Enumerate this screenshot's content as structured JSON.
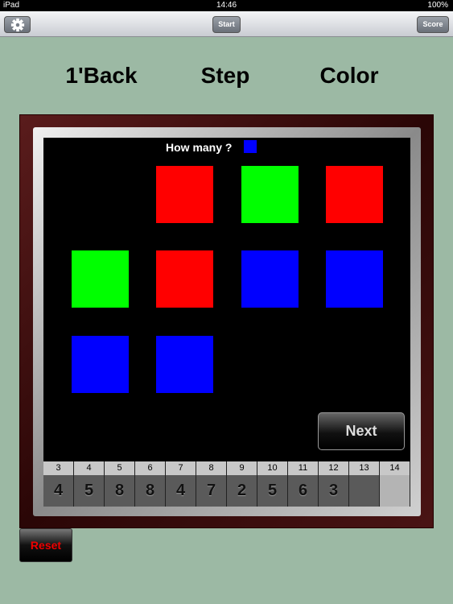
{
  "status": {
    "device": "iPad",
    "time": "14:46",
    "battery": "100%"
  },
  "toolbar": {
    "settings_icon": "gear-icon",
    "start": "Start",
    "score": "Score"
  },
  "titles": [
    "1'Back",
    "Step",
    "Color"
  ],
  "question": {
    "label": "How many ?",
    "color": "#0000ff"
  },
  "grid": [
    [
      null,
      "#ff0000",
      "#00ff00",
      "#ff0000"
    ],
    [
      "#00ff00",
      "#ff0000",
      "#0000ff",
      "#0000ff"
    ],
    [
      "#0000ff",
      "#0000ff",
      null,
      null
    ]
  ],
  "next": "Next",
  "history": [
    {
      "n": "3",
      "v": "4"
    },
    {
      "n": "4",
      "v": "5"
    },
    {
      "n": "5",
      "v": "8"
    },
    {
      "n": "6",
      "v": "8"
    },
    {
      "n": "7",
      "v": "4"
    },
    {
      "n": "8",
      "v": "7"
    },
    {
      "n": "9",
      "v": "2"
    },
    {
      "n": "10",
      "v": "5"
    },
    {
      "n": "11",
      "v": "6"
    },
    {
      "n": "12",
      "v": "3"
    },
    {
      "n": "13",
      "v": ""
    },
    {
      "n": "14",
      "v": ""
    }
  ],
  "reset": "Reset"
}
